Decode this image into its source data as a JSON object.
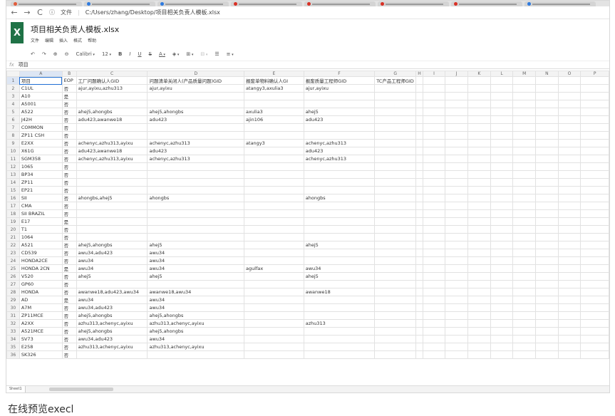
{
  "browser": {
    "tabs": [
      {
        "color": "#e25c3a"
      },
      {
        "color": "#2f7be0"
      },
      {
        "color": "#2f7be0"
      },
      {
        "color": "#d93025"
      },
      {
        "color": "#d93025"
      },
      {
        "color": "#d93025"
      },
      {
        "color": "#d93025"
      },
      {
        "color": "#2f7be0"
      }
    ],
    "address_label": "文件",
    "address": "C:/Users/zhang/Desktop/项目相关负责人模板.xlsx"
  },
  "app": {
    "logo": "X",
    "logo_color": "#1f7246",
    "doc_title": "项目相关负责人模板.xlsx",
    "menus": [
      "文件",
      "编辑",
      "插入",
      "格式",
      "帮助"
    ]
  },
  "toolbar": {
    "font": "Calibri",
    "size": "12",
    "bold": "B",
    "italic": "I",
    "underline": "U",
    "strike": "S",
    "text_color": "A"
  },
  "formula_bar": {
    "fx": "fx",
    "value": "项目"
  },
  "grid": {
    "columns": [
      "",
      "A",
      "B",
      "C",
      "D",
      "E",
      "F",
      "G",
      "H",
      "I",
      "J",
      "K",
      "L",
      "M",
      "N",
      "O",
      "P"
    ],
    "rows": [
      [
        "1",
        "项目",
        "EOP",
        "工厂问题确认人GID",
        "问题清单关闭人(产品质量问题)GID",
        "报废单物料确认人GI",
        "报废质量工程师GID",
        "TC产品工程师GID",
        "",
        "",
        "",
        "",
        "",
        "",
        "",
        "",
        ""
      ],
      [
        "2",
        "C1UL",
        "否",
        "ajur,ayixu,azhu313",
        "ajur,ayixu",
        "atangy3,axulia3",
        "ajur,ayixu",
        "",
        "",
        "",
        "",
        "",
        "",
        "",
        "",
        "",
        ""
      ],
      [
        "3",
        "A10",
        "是",
        "",
        "",
        "",
        "",
        "",
        "",
        "",
        "",
        "",
        "",
        "",
        "",
        "",
        ""
      ],
      [
        "4",
        "A5001",
        "否",
        "",
        "",
        "",
        "",
        "",
        "",
        "",
        "",
        "",
        "",
        "",
        "",
        "",
        ""
      ],
      [
        "5",
        "A522",
        "否",
        "ahej5,ahongbs",
        "ahej5,ahongbs",
        "axulia3",
        "ahej5",
        "",
        "",
        "",
        "",
        "",
        "",
        "",
        "",
        "",
        ""
      ],
      [
        "6",
        "J42H",
        "否",
        "adu423,awanwe18",
        "adu423",
        "ajin106",
        "adu423",
        "",
        "",
        "",
        "",
        "",
        "",
        "",
        "",
        "",
        ""
      ],
      [
        "7",
        "COMMON",
        "否",
        "",
        "",
        "",
        "",
        "",
        "",
        "",
        "",
        "",
        "",
        "",
        "",
        "",
        ""
      ],
      [
        "8",
        "ZP11 CSH",
        "否",
        "",
        "",
        "",
        "",
        "",
        "",
        "",
        "",
        "",
        "",
        "",
        "",
        "",
        ""
      ],
      [
        "9",
        "E2XX",
        "否",
        "achenyc,azhu313,ayixu",
        "achenyc,azhu313",
        "atangy3",
        "achenyc,azhu313",
        "",
        "",
        "",
        "",
        "",
        "",
        "",
        "",
        "",
        ""
      ],
      [
        "10",
        "X61G",
        "否",
        "adu423,awanwe18",
        "adu423",
        "",
        "adu423",
        "",
        "",
        "",
        "",
        "",
        "",
        "",
        "",
        "",
        ""
      ],
      [
        "11",
        "SGM358",
        "否",
        "achenyc,azhu313,ayixu",
        "achenyc,azhu313",
        "",
        "achenyc,azhu313",
        "",
        "",
        "",
        "",
        "",
        "",
        "",
        "",
        "",
        ""
      ],
      [
        "12",
        "1065",
        "否",
        "",
        "",
        "",
        "",
        "",
        "",
        "",
        "",
        "",
        "",
        "",
        "",
        "",
        ""
      ],
      [
        "13",
        "BP34",
        "否",
        "",
        "",
        "",
        "",
        "",
        "",
        "",
        "",
        "",
        "",
        "",
        "",
        "",
        ""
      ],
      [
        "14",
        "ZP11",
        "否",
        "",
        "",
        "",
        "",
        "",
        "",
        "",
        "",
        "",
        "",
        "",
        "",
        "",
        ""
      ],
      [
        "15",
        "EP21",
        "否",
        "",
        "",
        "",
        "",
        "",
        "",
        "",
        "",
        "",
        "",
        "",
        "",
        "",
        ""
      ],
      [
        "16",
        "SII",
        "否",
        "ahongbs,ahej5",
        "ahongbs",
        "",
        "ahongbs",
        "",
        "",
        "",
        "",
        "",
        "",
        "",
        "",
        "",
        ""
      ],
      [
        "17",
        "CMA",
        "否",
        "",
        "",
        "",
        "",
        "",
        "",
        "",
        "",
        "",
        "",
        "",
        "",
        "",
        ""
      ],
      [
        "18",
        "SII BRAZIL",
        "否",
        "",
        "",
        "",
        "",
        "",
        "",
        "",
        "",
        "",
        "",
        "",
        "",
        "",
        ""
      ],
      [
        "19",
        "E17",
        "是",
        "",
        "",
        "",
        "",
        "",
        "",
        "",
        "",
        "",
        "",
        "",
        "",
        "",
        ""
      ],
      [
        "20",
        "T1",
        "否",
        "",
        "",
        "",
        "",
        "",
        "",
        "",
        "",
        "",
        "",
        "",
        "",
        "",
        ""
      ],
      [
        "21",
        "1064",
        "否",
        "",
        "",
        "",
        "",
        "",
        "",
        "",
        "",
        "",
        "",
        "",
        "",
        "",
        ""
      ],
      [
        "22",
        "A521",
        "否",
        "ahej5,ahongbs",
        "ahej5",
        "",
        "ahej5",
        "",
        "",
        "",
        "",
        "",
        "",
        "",
        "",
        "",
        ""
      ],
      [
        "23",
        "CD539",
        "否",
        "awu34,adu423",
        "awu34",
        "",
        "",
        "",
        "",
        "",
        "",
        "",
        "",
        "",
        "",
        "",
        ""
      ],
      [
        "24",
        "HONDA2CE",
        "否",
        "awu34",
        "awu34",
        "",
        "",
        "",
        "",
        "",
        "",
        "",
        "",
        "",
        "",
        "",
        ""
      ],
      [
        "25",
        "HONDA 2CN",
        "是",
        "awu34",
        "awu34",
        "agulfax",
        "awu34",
        "",
        "",
        "",
        "",
        "",
        "",
        "",
        "",
        "",
        ""
      ],
      [
        "26",
        "V520",
        "否",
        "ahej5",
        "ahej5",
        "",
        "ahej5",
        "",
        "",
        "",
        "",
        "",
        "",
        "",
        "",
        "",
        ""
      ],
      [
        "27",
        "GP60",
        "否",
        "",
        "",
        "",
        "",
        "",
        "",
        "",
        "",
        "",
        "",
        "",
        "",
        "",
        ""
      ],
      [
        "28",
        "HONDA",
        "否",
        "awanwe18,adu423,awu34",
        "awanwe18,awu34",
        "",
        "awanwe18",
        "",
        "",
        "",
        "",
        "",
        "",
        "",
        "",
        "",
        ""
      ],
      [
        "29",
        "AD",
        "是",
        "awu34",
        "awu34",
        "",
        "",
        "",
        "",
        "",
        "",
        "",
        "",
        "",
        "",
        "",
        ""
      ],
      [
        "30",
        "A7M",
        "否",
        "awu34,adu423",
        "awu34",
        "",
        "",
        "",
        "",
        "",
        "",
        "",
        "",
        "",
        "",
        "",
        ""
      ],
      [
        "31",
        "ZP11MCE",
        "否",
        "ahej5,ahongbs",
        "ahej5,ahongbs",
        "",
        "",
        "",
        "",
        "",
        "",
        "",
        "",
        "",
        "",
        "",
        ""
      ],
      [
        "32",
        "A2XX",
        "否",
        "azhu313,achenyc,ayixu",
        "azhu313,achenyc,ayixu",
        "",
        "azhu313",
        "",
        "",
        "",
        "",
        "",
        "",
        "",
        "",
        "",
        ""
      ],
      [
        "33",
        "A521MCE",
        "否",
        "ahej5,ahongbs",
        "ahej5,ahongbs",
        "",
        "",
        "",
        "",
        "",
        "",
        "",
        "",
        "",
        "",
        "",
        ""
      ],
      [
        "34",
        "SV73",
        "否",
        "awu34,adu423",
        "awu34",
        "",
        "",
        "",
        "",
        "",
        "",
        "",
        "",
        "",
        "",
        "",
        ""
      ],
      [
        "35",
        "E258",
        "否",
        "azhu313,achenyc,ayixu",
        "azhu313,achenyc,ayixu",
        "",
        "",
        "",
        "",
        "",
        "",
        "",
        "",
        "",
        "",
        "",
        ""
      ],
      [
        "36",
        "SK326",
        "否",
        "",
        "",
        "",
        "",
        "",
        "",
        "",
        "",
        "",
        "",
        "",
        "",
        "",
        ""
      ]
    ]
  },
  "sheet_tabs": [
    "Sheet1"
  ],
  "caption": "在线预览execl"
}
